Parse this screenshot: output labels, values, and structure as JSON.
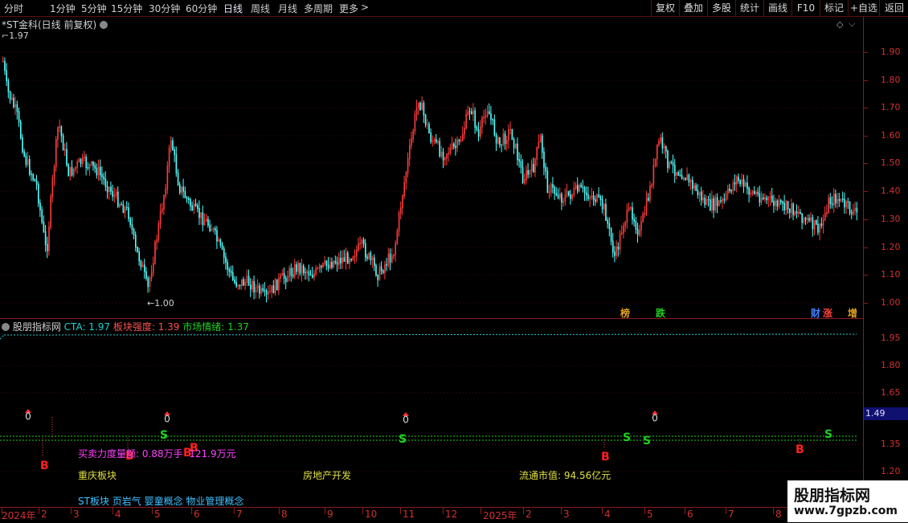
{
  "toolbar": {
    "periods": [
      "分时",
      "1分钟",
      "5分钟",
      "15分钟",
      "30分钟",
      "60分钟",
      "日线",
      "周线",
      "月线",
      "多周期",
      "更多"
    ],
    "active": "日线",
    "more_arrow": ">",
    "right_buttons": [
      "复权",
      "叠加",
      "多股",
      "统计",
      "画线",
      "F10",
      "标记",
      "+自选",
      "返回"
    ]
  },
  "main_panel": {
    "title": "*ST金科(日线 前复权)",
    "high_label": "1.97",
    "low_label": "1.00",
    "badges": [
      {
        "text": "榜",
        "color": "#e0a020"
      },
      {
        "text": "跌",
        "color": "#20d020"
      },
      {
        "text": "财",
        "color": "#4080ff"
      },
      {
        "text": "涨",
        "color": "#ff4040"
      },
      {
        "text": "增",
        "color": "#e0a020"
      }
    ]
  },
  "price_axis": [
    "1.90",
    "1.80",
    "1.70",
    "1.60",
    "1.50",
    "1.40",
    "1.30",
    "1.20",
    "1.10",
    "1.00"
  ],
  "indicator_panel": {
    "name": "股朋指标网",
    "cta_label": "CTA: 1.97",
    "strength_label": "板块强度: 1.39",
    "sentiment_label": "市场情绪: 1.37",
    "axis": [
      "1.95",
      "1.80",
      "1.65",
      "1.35",
      "1.20"
    ],
    "current_price": "1.49",
    "buy_marker": "B",
    "sell_marker": "S",
    "net_label": "买卖力度量额: ",
    "net_value1": "0.88万手",
    "net_value2": "121.9万元",
    "sector": "重庆板块",
    "industry": "房地产开发",
    "cap_label": "流通市值: ",
    "cap_value": "94.56亿元",
    "concepts": "ST板块 页岩气 婴童概念 物业管理概念"
  },
  "date_axis": [
    "2024年",
    "2",
    "3",
    "4",
    "5",
    "6",
    "7",
    "8",
    "9",
    "10",
    "11",
    "12",
    "2025年",
    "2",
    "3",
    "4",
    "5",
    "6",
    "7",
    "8"
  ],
  "watermark": {
    "line1": "股朋指标网",
    "line2": "www.7gpzb.com"
  },
  "colors": {
    "up": "#ff3c3c",
    "down": "#54ffff",
    "axis": "#d03030",
    "grid": "#8b1a1a",
    "cyan_line": "#20d0d0",
    "green_line": "#20d020"
  }
}
